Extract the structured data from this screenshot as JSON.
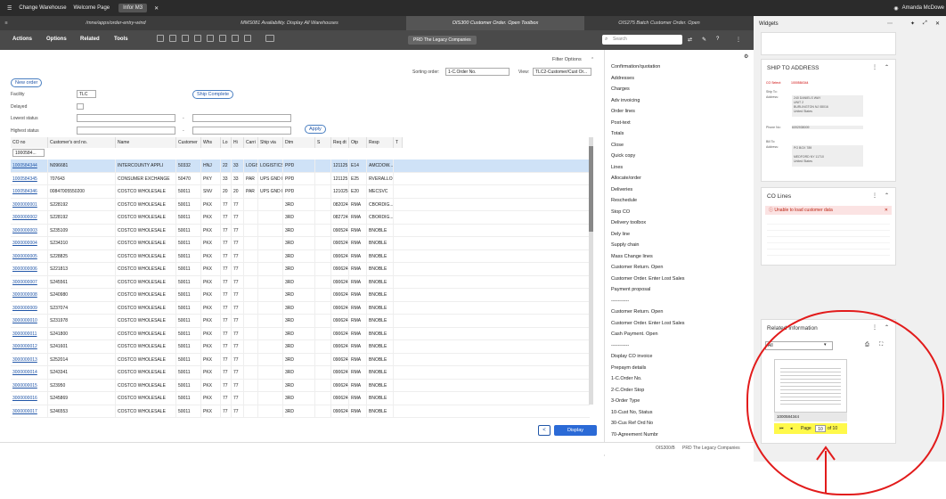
{
  "topbar": {
    "change_warehouse": "Change Warehouse",
    "welcome": "Welcome Page",
    "infor": "Infor M3",
    "user": "Amanda McDowe"
  },
  "tabs": [
    "/mne/apps/order-entry-wind",
    "MMS081 Availability. Display All Warehouses",
    "OIS300 Customer Order. Open Toolbox",
    "OIS275 Batch Customer Order. Open"
  ],
  "toolbar": {
    "menus": [
      "Actions",
      "Options",
      "Related",
      "Tools"
    ],
    "context": "PRD The Legacy Companies",
    "search_placeholder": "Search"
  },
  "filters": {
    "filter_options": "Filter Options",
    "sorting_label": "Sorting order:",
    "sorting_value": "1-C.Order No.",
    "view_label": "View:",
    "view_value": "TLC2-Customer/Cust Or...",
    "new_order": "New order",
    "ship_complete": "Ship Complete",
    "apply": "Apply",
    "facility_label": "Facility",
    "facility_value": "TLC",
    "delayed_label": "Delayed",
    "lowest_label": "Lowest status",
    "highest_label": "Highest status",
    "co_no_filter": "1000584..."
  },
  "grid": {
    "columns": [
      "CO no",
      "Customer's ord no.",
      "Name",
      "Customer",
      "Whs",
      "Lo",
      "Hi",
      "Carri",
      "Ship via",
      "Dtm",
      "S",
      "Req dt",
      "Otp",
      "Resp",
      "T"
    ],
    "rows": [
      [
        "1000584344",
        "N096681",
        "INTERCOUNTY APPLI",
        "50332",
        "HNJ",
        "22",
        "33",
        "LOGIS",
        "LOGISTICS",
        "PPD",
        "",
        "121125",
        "E14",
        "AMCDOW..."
      ],
      [
        "1000584345",
        "707643",
        "CONSUMER EXCHANGE",
        "50470",
        "PKY",
        "33",
        "33",
        "PAR",
        "UPS GND R",
        "PPD",
        "",
        "121125",
        "E25",
        "RVERALLO"
      ],
      [
        "1000584346",
        "00847005550200",
        "COSTCO WHOLESALE",
        "50011",
        "SNV",
        "20",
        "20",
        "PAR",
        "UPS GND R",
        "PPD",
        "",
        "121025",
        "E20",
        "MECSVC"
      ],
      [
        "3000000001",
        "S228192",
        "COSTCO WHOLESALE",
        "50011",
        "PKX",
        "77",
        "77",
        "",
        "",
        "3RD",
        "",
        "082024",
        "RMA",
        "CBORDIG..."
      ],
      [
        "3000000002",
        "S228192",
        "COSTCO WHOLESALE",
        "50011",
        "PKX",
        "77",
        "77",
        "",
        "",
        "3RD",
        "",
        "082724",
        "RMA",
        "CBORDIG..."
      ],
      [
        "3000000003",
        "S235109",
        "COSTCO WHOLESALE",
        "50011",
        "PKX",
        "77",
        "77",
        "",
        "",
        "3RD",
        "",
        "090524",
        "RMA",
        "BNOBLE"
      ],
      [
        "3000000004",
        "S234310",
        "COSTCO WHOLESALE",
        "50011",
        "PKX",
        "77",
        "77",
        "",
        "",
        "3RD",
        "",
        "090524",
        "RMA",
        "BNOBLE"
      ],
      [
        "3000000005",
        "S228825",
        "COSTCO WHOLESALE",
        "50011",
        "PKX",
        "77",
        "77",
        "",
        "",
        "3RD",
        "",
        "090624",
        "RMA",
        "BNOBLE"
      ],
      [
        "3000000006",
        "S221813",
        "COSTCO WHOLESALE",
        "50011",
        "PKX",
        "77",
        "77",
        "",
        "",
        "3RD",
        "",
        "090624",
        "RMA",
        "BNOBLE"
      ],
      [
        "3000000007",
        "S245561",
        "COSTCO WHOLESALE",
        "50011",
        "PKX",
        "77",
        "77",
        "",
        "",
        "3RD",
        "",
        "090624",
        "RMA",
        "BNOBLE"
      ],
      [
        "3000000008",
        "S240980",
        "COSTCO WHOLESALE",
        "50011",
        "PKX",
        "77",
        "77",
        "",
        "",
        "3RD",
        "",
        "090624",
        "RMA",
        "BNOBLE"
      ],
      [
        "3000000009",
        "S237074",
        "COSTCO WHOLESALE",
        "50011",
        "PKX",
        "77",
        "77",
        "",
        "",
        "3RD",
        "",
        "090624",
        "RMA",
        "BNOBLE"
      ],
      [
        "3000000010",
        "S231978",
        "COSTCO WHOLESALE",
        "50011",
        "PKX",
        "77",
        "77",
        "",
        "",
        "3RD",
        "",
        "090624",
        "RMA",
        "BNOBLE"
      ],
      [
        "3000000011",
        "S241800",
        "COSTCO WHOLESALE",
        "50011",
        "PKX",
        "77",
        "77",
        "",
        "",
        "3RD",
        "",
        "090624",
        "RMA",
        "BNOBLE"
      ],
      [
        "3000000012",
        "S241601",
        "COSTCO WHOLESALE",
        "50011",
        "PKX",
        "77",
        "77",
        "",
        "",
        "3RD",
        "",
        "090624",
        "RMA",
        "BNOBLE"
      ],
      [
        "3000000013",
        "S252014",
        "COSTCO WHOLESALE",
        "50011",
        "PKX",
        "77",
        "77",
        "",
        "",
        "3RD",
        "",
        "090624",
        "RMA",
        "BNOBLE"
      ],
      [
        "3000000014",
        "S243341",
        "COSTCO WHOLESALE",
        "50011",
        "PKX",
        "77",
        "77",
        "",
        "",
        "3RD",
        "",
        "090624",
        "RMA",
        "BNOBLE"
      ],
      [
        "3000000015",
        "S23950",
        "COSTCO WHOLESALE",
        "50011",
        "PKX",
        "77",
        "77",
        "",
        "",
        "3RD",
        "",
        "090624",
        "RMA",
        "BNOBLE"
      ],
      [
        "3000000016",
        "S245869",
        "COSTCO WHOLESALE",
        "50011",
        "PKX",
        "77",
        "77",
        "",
        "",
        "3RD",
        "",
        "090624",
        "RMA",
        "BNOBLE"
      ],
      [
        "3000000017",
        "S246553",
        "COSTCO WHOLESALE",
        "50011",
        "PKX",
        "77",
        "77",
        "",
        "",
        "3RD",
        "",
        "090624",
        "RMA",
        "BNOBLE"
      ]
    ]
  },
  "display_button": "Display",
  "footer": {
    "program": "OIS300/B",
    "company": "PRD The Legacy Companies"
  },
  "options": [
    "Confirmation/quotation",
    "Addresses",
    "Charges",
    "Adv invoicing",
    "Order lines",
    "Post-text",
    "Totals",
    "Close",
    "Quick copy",
    "Lines",
    "Allocate/order",
    "Deliveries",
    "Reschedule",
    "Stop CO",
    "Delivery toolbox",
    "Dely line",
    "Supply chain",
    "Mass Change lines",
    "Customer Return. Open",
    "Customer Order. Enter Lost Sales",
    "Payment proposal",
    "-----------",
    "Customer Return. Open",
    "Customer Order. Enter Lost Sales",
    "Cash Payment. Open",
    "-----------",
    "Display CO invoice",
    "Prepaym details",
    "1-C.Order No.",
    "2-C.Order Stop",
    "3-Order Type",
    "10-Cust No, Status",
    "30-Cus Ref Ord No",
    "70-Agreement Numbr"
  ],
  "widgets": {
    "title": "Widgets",
    "ship_to": {
      "title": "SHIP TO ADDRESS",
      "co_select_label": "CO Select:",
      "co_select_value": "1000584344",
      "ship_to_label": "Ship To:",
      "address_label": "Address:",
      "address_lines": [
        "240 DANIELS WAY",
        "UNIT 2",
        "BURLINGTON NJ 08016",
        "United States"
      ],
      "phone_label": "Phone No:",
      "phone_value": "6092938009",
      "bill_to_label": "Bill To:",
      "bill_address_label": "Address:",
      "bill_lines": [
        "PO BOX 789",
        "",
        "MEDFORD NY 11710",
        "United States"
      ]
    },
    "co_lines": {
      "title": "CO Lines",
      "error": "Unable to load customer data"
    },
    "related": {
      "title": "Related Information",
      "filter": "All",
      "doc_name": "1000584344",
      "page_label": "Page",
      "page_value": "10",
      "of_label": "of 10"
    }
  }
}
